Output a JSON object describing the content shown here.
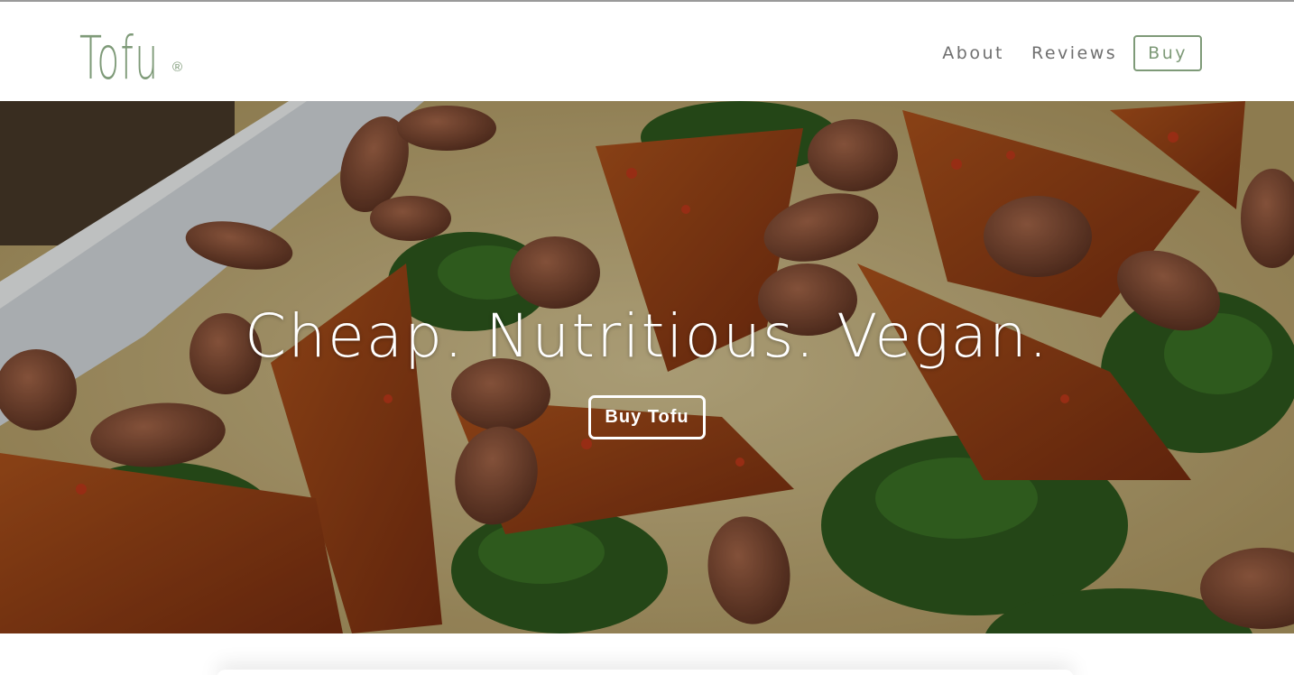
{
  "brand": {
    "logo_text": "Tofu",
    "registered_mark": "®",
    "color": "#7e9a78"
  },
  "nav": {
    "items": [
      {
        "label": "About"
      },
      {
        "label": "Reviews"
      }
    ],
    "buy_label": "Buy"
  },
  "hero": {
    "headline": "Cheap. Nutritious. Vegan.",
    "cta_label": "Buy Tofu",
    "image_description_icon": "food-photo-icon"
  },
  "colors": {
    "accent": "#7e9a78",
    "nav_text": "#6f6f6f",
    "hero_text": "#ffffff"
  }
}
